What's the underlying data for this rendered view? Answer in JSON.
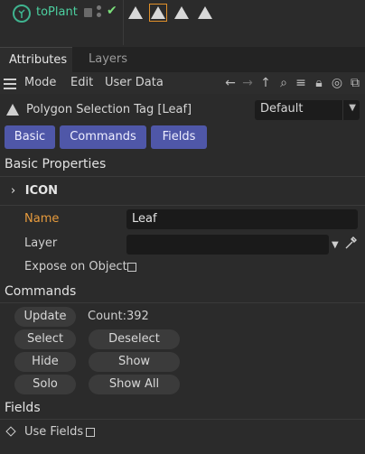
{
  "object": {
    "name": "toPlant"
  },
  "tabs": [
    {
      "label": "Attributes"
    },
    {
      "label": "Layers"
    }
  ],
  "menu": {
    "mode": "Mode",
    "edit": "Edit",
    "user_data": "User Data"
  },
  "tag": {
    "title": "Polygon Selection Tag [Leaf]",
    "mode_value": "Default"
  },
  "groups": [
    {
      "label": "Basic"
    },
    {
      "label": "Commands"
    },
    {
      "label": "Fields"
    }
  ],
  "basic": {
    "section_title": "Basic Properties",
    "icon_group": "ICON",
    "name_label": "Name",
    "name_value": "Leaf",
    "layer_label": "Layer",
    "layer_value": "",
    "expose_label": "Expose on Object"
  },
  "commands": {
    "section_title": "Commands",
    "update": "Update",
    "count": "Count:392",
    "select": "Select",
    "deselect": "Deselect",
    "hide": "Hide",
    "show": "Show",
    "solo": "Solo",
    "show_all": "Show All"
  },
  "fields": {
    "section_title": "Fields",
    "use_fields_label": "Use Fields"
  },
  "colors": {
    "accent_group": "#4f57a8",
    "object_name": "#4cd0a0",
    "highlight_label": "#e79b3d",
    "selection_outline": "#e0902a"
  }
}
